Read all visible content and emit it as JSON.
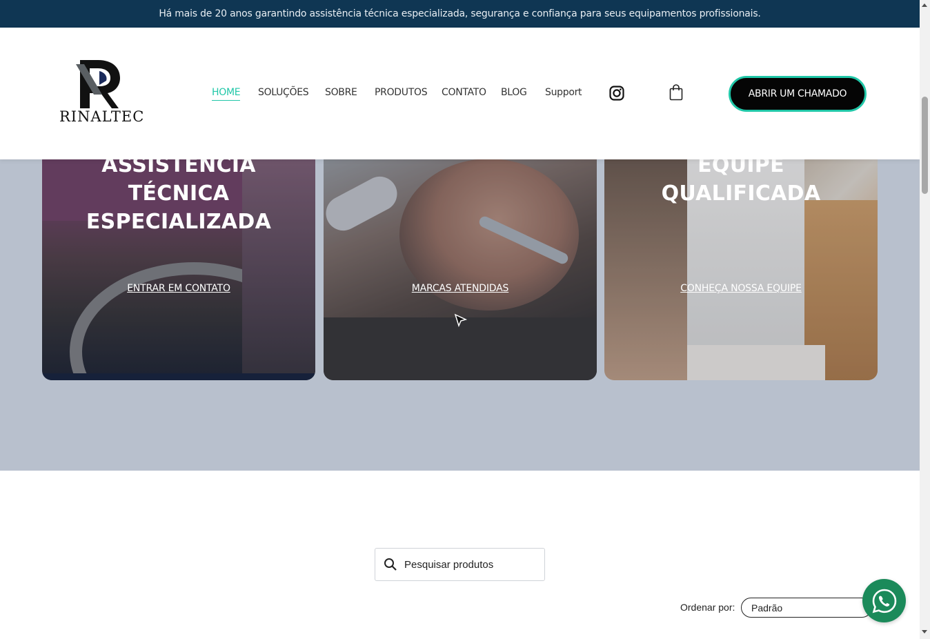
{
  "topbar": {
    "message": "Há mais de 20 anos garantindo assistência técnica especializada, segurança e confiança para seus equipamentos profissionais."
  },
  "header": {
    "logo_text": "RINALTEC",
    "nav": [
      {
        "label": "HOME",
        "active": true
      },
      {
        "label": "SOLUÇÕES",
        "active": false
      },
      {
        "label": "SOBRE",
        "active": false
      },
      {
        "label": "PRODUTOS",
        "active": false
      },
      {
        "label": "CONTATO",
        "active": false
      },
      {
        "label": "BLOG",
        "active": false
      },
      {
        "label": "Support",
        "active": false
      }
    ],
    "instagram_icon": "instagram-icon",
    "cart_icon": "shopping-bag-icon",
    "cta_label": "ABRIR UM CHAMADO"
  },
  "cards": [
    {
      "title_lines": [
        "ASSISTÊNCIA",
        "TÉCNICA",
        "ESPECIALIZADA"
      ],
      "link": "ENTRAR EM CONTATO"
    },
    {
      "title_lines": [],
      "link": "MARCAS ATENDIDAS"
    },
    {
      "title_lines": [
        "EQUIPE",
        "QUALIFICADA"
      ],
      "link": "CONHEÇA NOSSA EQUIPE"
    }
  ],
  "products": {
    "search_placeholder": "Pesquisar produtos",
    "sort_label": "Ordenar por:",
    "sort_value": "Padrão"
  },
  "colors": {
    "topbar_bg": "#0f3653",
    "accent": "#21c7a8",
    "hero_bg": "#b8c0cd",
    "whatsapp": "#1b8a5a"
  }
}
